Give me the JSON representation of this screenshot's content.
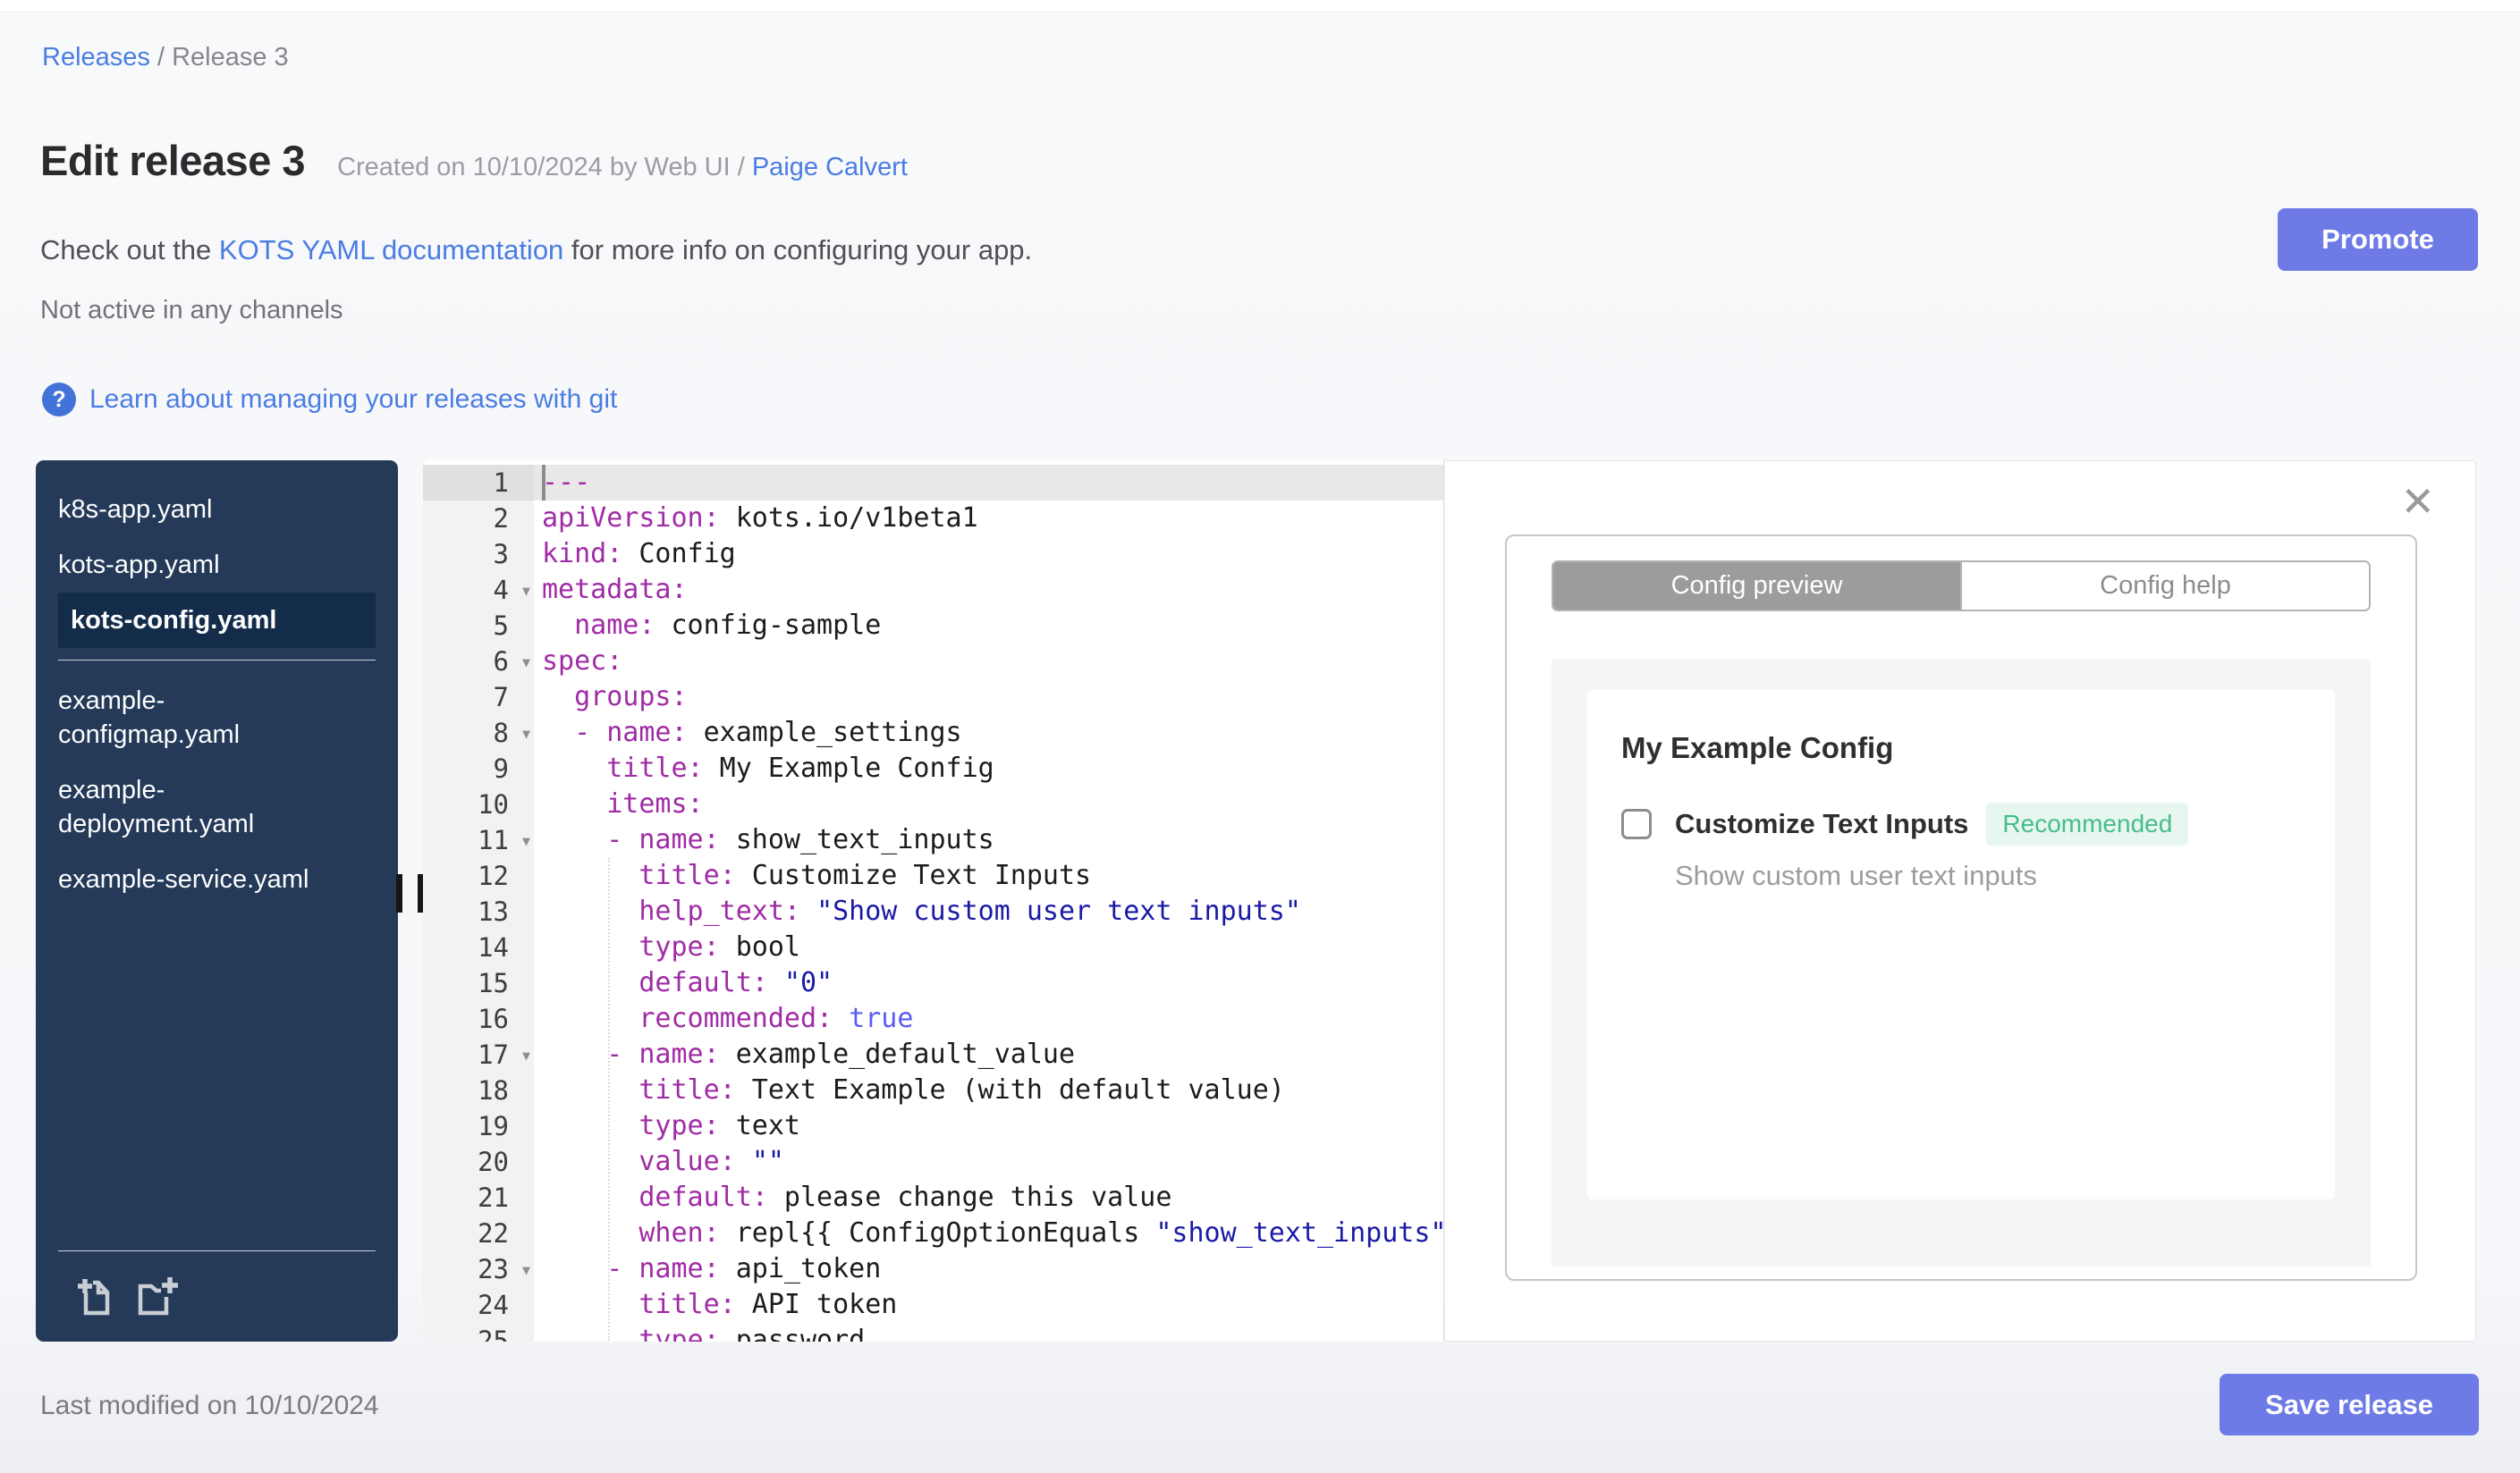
{
  "colors": {
    "accent": "#6e7be6",
    "link": "#4a7de2",
    "sidebar_bg": "#243a58",
    "sidebar_selected_bg": "#132c4a",
    "yaml_key": "#a02ca5",
    "yaml_string": "#1a1aa6",
    "yaml_bool": "#585cf6",
    "badge_green": "#46bd8a",
    "badge_bg": "#e7f7ef",
    "tab_active_bg": "#9c9c9c"
  },
  "breadcrumb": {
    "link": "Releases",
    "separator": " / ",
    "current": "Release 3"
  },
  "header": {
    "title": "Edit release 3",
    "created_prefix": "Created on 10/10/2024 by Web UI / ",
    "created_link": "Paige Calvert",
    "doc_prefix": "Check out the ",
    "doc_link": "KOTS YAML documentation",
    "doc_suffix": " for more info on configuring your app.",
    "channel_status": "Not active in any channels",
    "promote_label": "Promote",
    "help_glyph": "?",
    "git_link": "Learn about managing your releases with git"
  },
  "sidebar": {
    "selected": "kots-config.yaml",
    "groups": [
      [
        "k8s-app.yaml",
        "kots-app.yaml",
        "kots-config.yaml"
      ],
      [
        "example-configmap.yaml",
        "example-deployment.yaml",
        "example-service.yaml"
      ]
    ],
    "icons": [
      "new-file-icon",
      "new-folder-icon"
    ]
  },
  "editor": {
    "active_line": 1,
    "fold_lines": [
      4,
      6,
      8,
      11,
      17,
      23
    ],
    "lines": [
      {
        "tokens": [
          [
            "k",
            "---"
          ]
        ]
      },
      {
        "tokens": [
          [
            "k",
            "apiVersion:"
          ],
          [
            "p",
            " kots.io/v1beta1"
          ]
        ]
      },
      {
        "tokens": [
          [
            "k",
            "kind:"
          ],
          [
            "p",
            " Config"
          ]
        ]
      },
      {
        "tokens": [
          [
            "k",
            "metadata:"
          ]
        ]
      },
      {
        "tokens": [
          [
            "p",
            "  "
          ],
          [
            "k",
            "name:"
          ],
          [
            "p",
            " config-sample"
          ]
        ]
      },
      {
        "tokens": [
          [
            "k",
            "spec:"
          ]
        ]
      },
      {
        "tokens": [
          [
            "p",
            "  "
          ],
          [
            "k",
            "groups:"
          ]
        ]
      },
      {
        "tokens": [
          [
            "p",
            "  "
          ],
          [
            "k",
            "- "
          ],
          [
            "k",
            "name:"
          ],
          [
            "p",
            " example_settings"
          ]
        ]
      },
      {
        "tokens": [
          [
            "p",
            "    "
          ],
          [
            "k",
            "title:"
          ],
          [
            "p",
            " My Example Config"
          ]
        ]
      },
      {
        "tokens": [
          [
            "p",
            "    "
          ],
          [
            "k",
            "items:"
          ]
        ]
      },
      {
        "tokens": [
          [
            "p",
            "    "
          ],
          [
            "k",
            "- "
          ],
          [
            "k",
            "name:"
          ],
          [
            "p",
            " show_text_inputs"
          ]
        ]
      },
      {
        "tokens": [
          [
            "p",
            "      "
          ],
          [
            "k",
            "title:"
          ],
          [
            "p",
            " Customize Text Inputs"
          ]
        ]
      },
      {
        "tokens": [
          [
            "p",
            "      "
          ],
          [
            "k",
            "help_text:"
          ],
          [
            "p",
            " "
          ],
          [
            "s",
            "\"Show custom user text inputs\""
          ]
        ]
      },
      {
        "tokens": [
          [
            "p",
            "      "
          ],
          [
            "k",
            "type:"
          ],
          [
            "p",
            " bool"
          ]
        ]
      },
      {
        "tokens": [
          [
            "p",
            "      "
          ],
          [
            "k",
            "default:"
          ],
          [
            "p",
            " "
          ],
          [
            "s",
            "\"0\""
          ]
        ]
      },
      {
        "tokens": [
          [
            "p",
            "      "
          ],
          [
            "k",
            "recommended:"
          ],
          [
            "p",
            " "
          ],
          [
            "b",
            "true"
          ]
        ]
      },
      {
        "tokens": [
          [
            "p",
            "    "
          ],
          [
            "k",
            "- "
          ],
          [
            "k",
            "name:"
          ],
          [
            "p",
            " example_default_value"
          ]
        ]
      },
      {
        "tokens": [
          [
            "p",
            "      "
          ],
          [
            "k",
            "title:"
          ],
          [
            "p",
            " Text Example (with default value)"
          ]
        ]
      },
      {
        "tokens": [
          [
            "p",
            "      "
          ],
          [
            "k",
            "type:"
          ],
          [
            "p",
            " text"
          ]
        ]
      },
      {
        "tokens": [
          [
            "p",
            "      "
          ],
          [
            "k",
            "value:"
          ],
          [
            "p",
            " "
          ],
          [
            "s",
            "\"\""
          ]
        ]
      },
      {
        "tokens": [
          [
            "p",
            "      "
          ],
          [
            "k",
            "default:"
          ],
          [
            "p",
            " please change this value"
          ]
        ]
      },
      {
        "tokens": [
          [
            "p",
            "      "
          ],
          [
            "k",
            "when:"
          ],
          [
            "p",
            " repl{{ ConfigOptionEquals "
          ],
          [
            "s",
            "\"show_text_inputs\""
          ]
        ]
      },
      {
        "tokens": [
          [
            "p",
            "    "
          ],
          [
            "k",
            "- "
          ],
          [
            "k",
            "name:"
          ],
          [
            "p",
            " api_token"
          ]
        ]
      },
      {
        "tokens": [
          [
            "p",
            "      "
          ],
          [
            "k",
            "title:"
          ],
          [
            "p",
            " API token"
          ]
        ]
      },
      {
        "tokens": [
          [
            "p",
            "      "
          ],
          [
            "k",
            "type:"
          ],
          [
            "p",
            " password"
          ]
        ]
      }
    ]
  },
  "preview": {
    "tabs": [
      {
        "label": "Config preview",
        "active": true
      },
      {
        "label": "Config help",
        "active": false
      }
    ],
    "close_glyph": "✕",
    "group_title": "My Example Config",
    "item": {
      "label": "Customize Text Inputs",
      "badge": "Recommended",
      "help": "Show custom user text inputs",
      "checked": false
    }
  },
  "footer": {
    "last_modified": "Last modified on 10/10/2024",
    "save_label": "Save release"
  }
}
